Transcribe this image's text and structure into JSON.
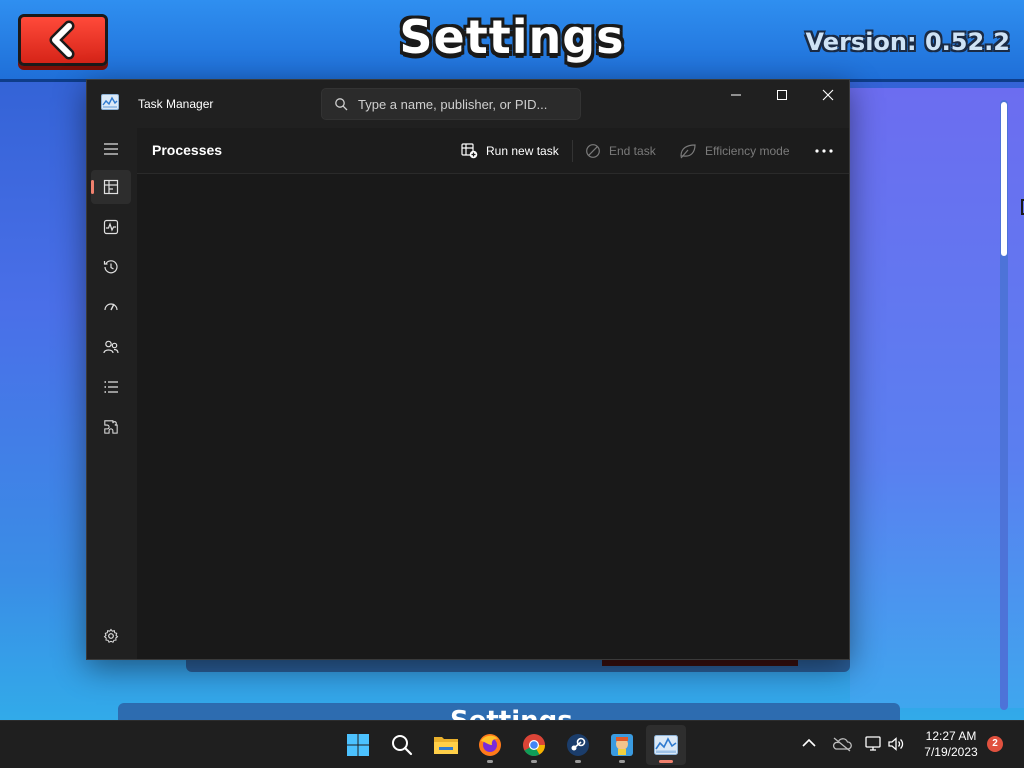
{
  "game": {
    "title": "Settings",
    "version": "Version: 0.52.2",
    "section_title": "Settings"
  },
  "task_manager": {
    "window_title": "Task Manager",
    "search": {
      "placeholder": "Type a name, publisher, or PID..."
    },
    "page_title": "Processes",
    "toolbar": {
      "run_new_task": "Run new task",
      "end_task": "End task",
      "efficiency_mode": "Efficiency mode"
    },
    "nav_items": [
      {
        "name": "Processes",
        "icon": "processes-icon",
        "active": true
      },
      {
        "name": "Performance",
        "icon": "performance-icon",
        "active": false
      },
      {
        "name": "App history",
        "icon": "app-history-icon",
        "active": false
      },
      {
        "name": "Startup apps",
        "icon": "startup-apps-icon",
        "active": false
      },
      {
        "name": "Users",
        "icon": "users-icon",
        "active": false
      },
      {
        "name": "Details",
        "icon": "details-icon",
        "active": false
      },
      {
        "name": "Services",
        "icon": "services-icon",
        "active": false
      }
    ],
    "accent_color": "#f0816e"
  },
  "taskbar": {
    "apps": [
      {
        "name": "start",
        "icon": "windows-start-icon"
      },
      {
        "name": "search",
        "icon": "search-icon"
      },
      {
        "name": "file-explorer",
        "icon": "folder-icon"
      },
      {
        "name": "firefox",
        "icon": "firefox-icon"
      },
      {
        "name": "chrome",
        "icon": "chrome-icon"
      },
      {
        "name": "steam",
        "icon": "steam-icon"
      },
      {
        "name": "game",
        "icon": "game-icon"
      },
      {
        "name": "task-manager",
        "icon": "task-manager-icon"
      }
    ],
    "clock": {
      "time": "12:27 AM",
      "date": "7/19/2023"
    },
    "notification_count": "2"
  }
}
